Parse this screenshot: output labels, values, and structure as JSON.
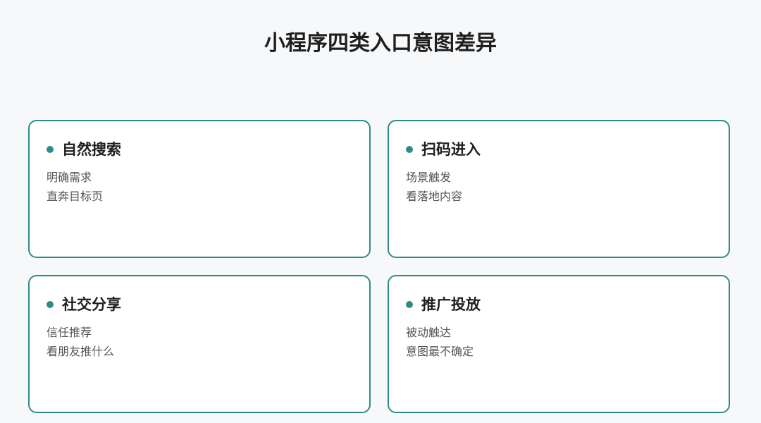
{
  "title": "小程序四类入口意图差异",
  "accent_color": "#2e8b87",
  "cards": [
    {
      "title": "自然搜索",
      "lines": [
        "明确需求",
        "直奔目标页"
      ]
    },
    {
      "title": "扫码进入",
      "lines": [
        "场景触发",
        "看落地内容"
      ]
    },
    {
      "title": "社交分享",
      "lines": [
        "信任推荐",
        "看朋友推什么"
      ]
    },
    {
      "title": "推广投放",
      "lines": [
        "被动触达",
        "意图最不确定"
      ]
    }
  ]
}
